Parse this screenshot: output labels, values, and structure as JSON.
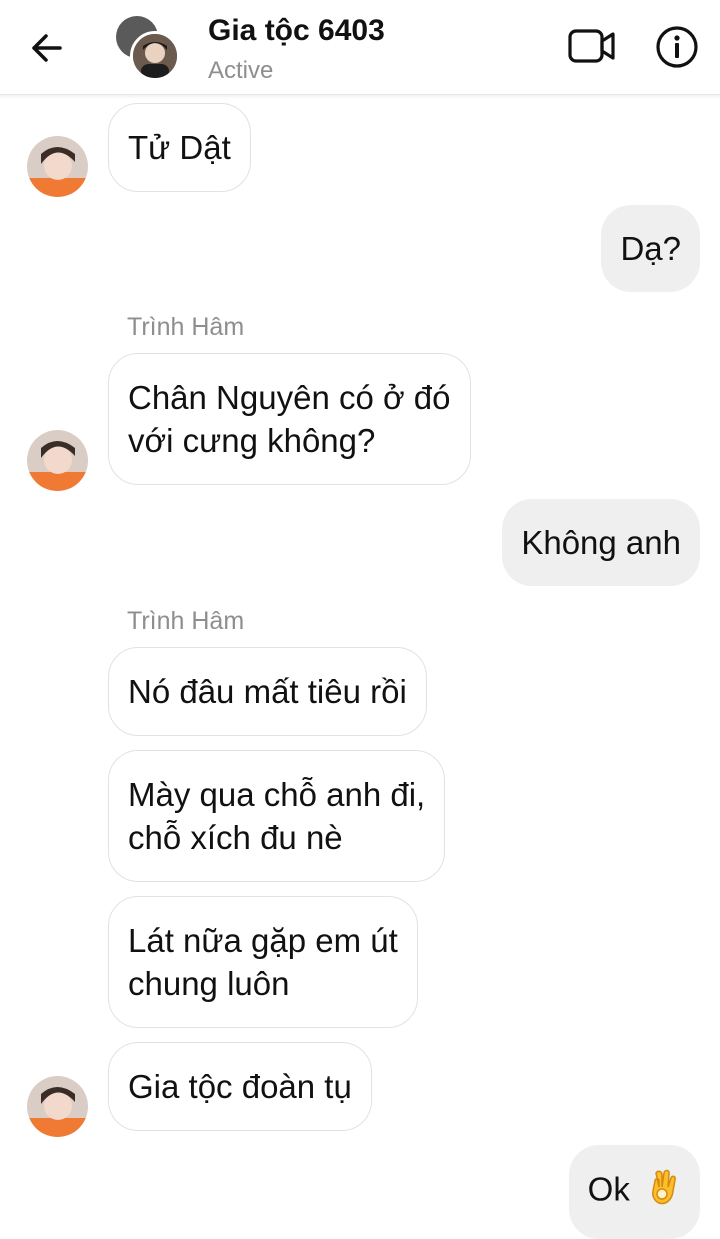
{
  "header": {
    "title": "Gia tộc 6403",
    "status": "Active"
  },
  "messages": [
    {
      "direction": "in",
      "text": "Tử Dật"
    },
    {
      "direction": "out",
      "text": "Dạ?"
    },
    {
      "direction": "in",
      "sender": "Trình Hâm",
      "lines": [
        "Chân Nguyên có ở đó",
        "với cưng không?"
      ]
    },
    {
      "direction": "out",
      "text": "Không anh"
    },
    {
      "direction": "in",
      "sender": "Trình Hâm",
      "text": "Nó đâu mất tiêu rồi"
    },
    {
      "direction": "in",
      "lines": [
        "Mày qua chỗ anh đi,",
        "chỗ xích đu nè"
      ]
    },
    {
      "direction": "in",
      "lines": [
        "Lát nữa gặp em út",
        "chung luôn"
      ]
    },
    {
      "direction": "in",
      "text": "Gia tộc đoàn tụ"
    },
    {
      "direction": "out",
      "text": "Ok",
      "emoji": "ok-hand-emoji"
    }
  ]
}
